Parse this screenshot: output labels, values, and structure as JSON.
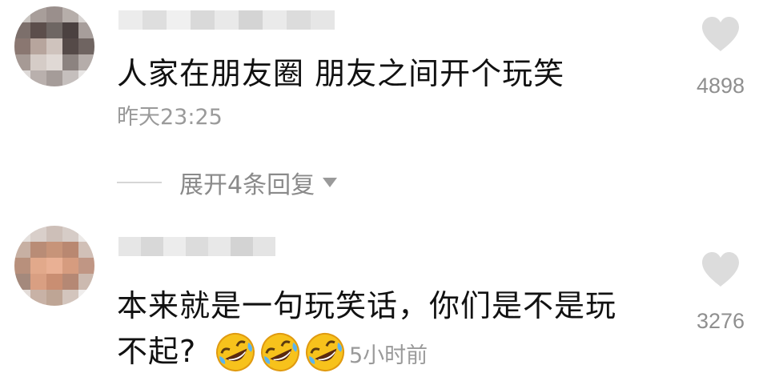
{
  "comments": [
    {
      "text": "人家在朋友圈 朋友之间开个玩笑",
      "time": "昨天23:25",
      "likes": "4898",
      "replies_label": "展开4条回复"
    },
    {
      "text_line1": "本来就是一句玩笑话，你们是不是玩",
      "text_line2": "不起?",
      "emoji_count": 3,
      "time": "5小时前",
      "likes": "3276"
    }
  ],
  "icons": {
    "like": "heart-icon",
    "expand": "triangle-down-icon",
    "emoji": "rolling-laughing-emoji"
  },
  "colors": {
    "text": "#111111",
    "meta": "#9a9a9a",
    "heart": "#dcdcdc"
  }
}
